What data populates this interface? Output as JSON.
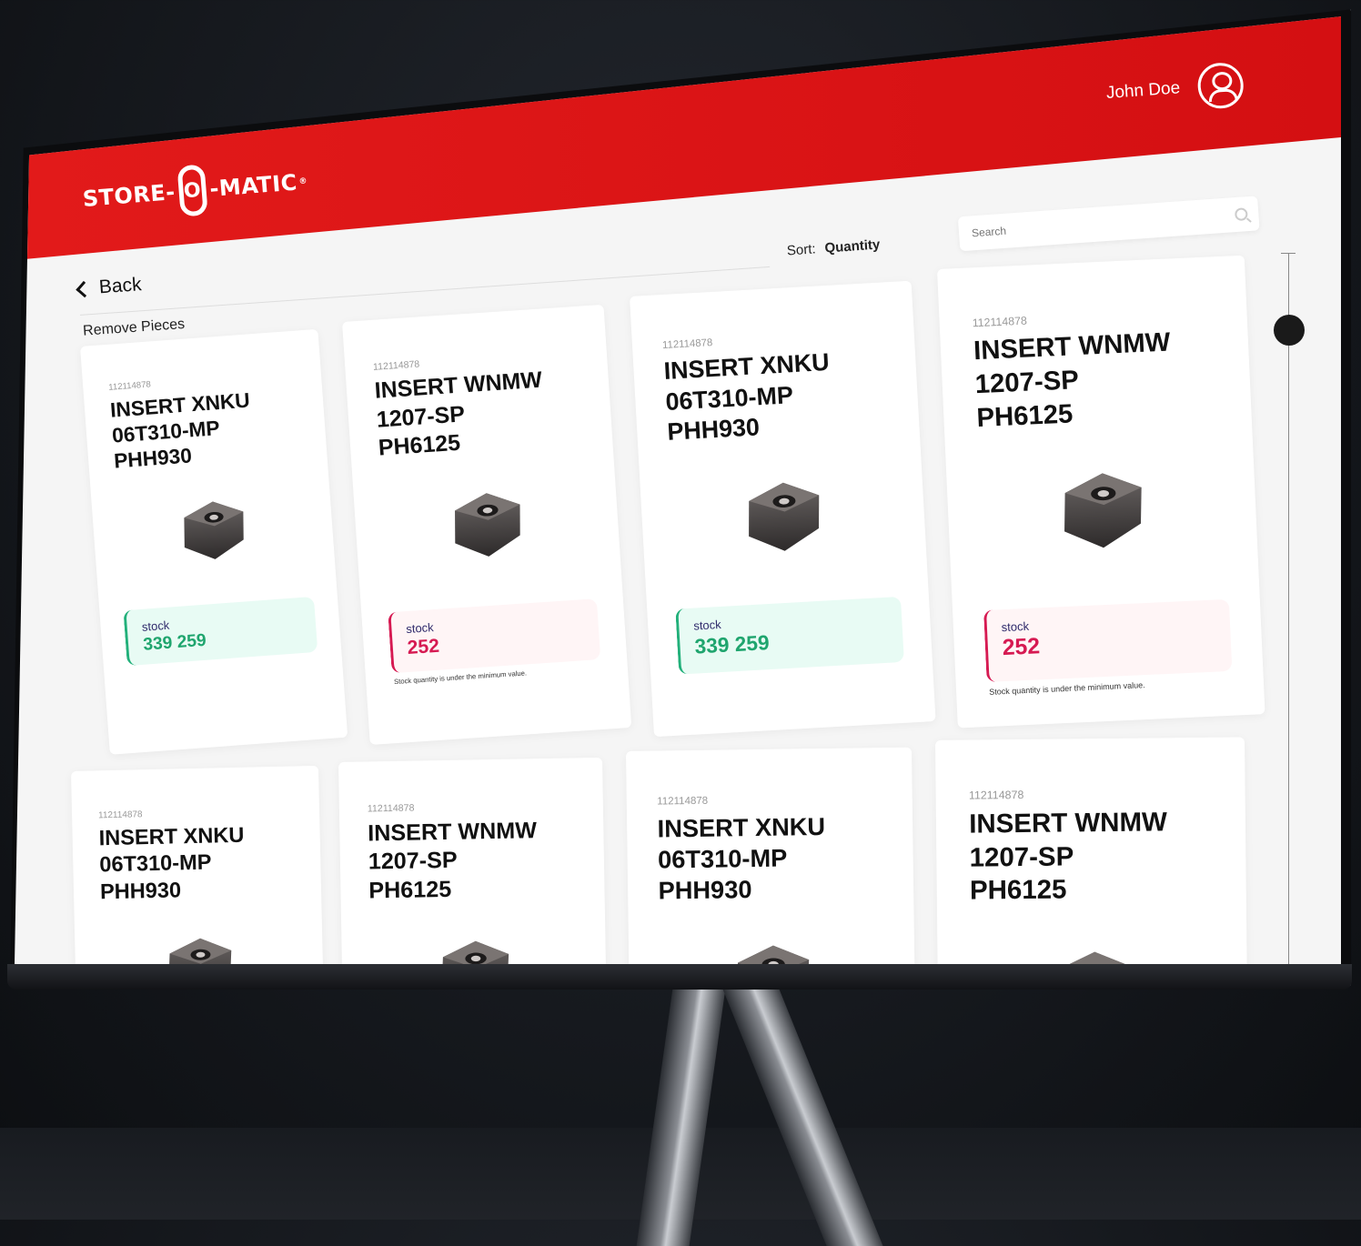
{
  "header": {
    "logo": {
      "left": "STORE-",
      "mark": "O",
      "right": "-MATIC",
      "reg": "®"
    },
    "user_name": "John Doe"
  },
  "toolbar": {
    "back_label": "Back",
    "section_title": "Remove Pieces",
    "sort_label": "Sort:",
    "sort_value": "Quantity",
    "search_placeholder": "Search"
  },
  "cards": [
    {
      "sku": "112114878",
      "name": "INSERT XNKU\n06T310-MP\nPHH930",
      "stock_label": "stock",
      "stock_value": "339 259",
      "status": "ok",
      "note": ""
    },
    {
      "sku": "112114878",
      "name": "INSERT WNMW\n1207-SP\nPH6125",
      "stock_label": "stock",
      "stock_value": "252",
      "status": "low",
      "note": "Stock quantity is under the minimum value."
    },
    {
      "sku": "112114878",
      "name": "INSERT XNKU\n06T310-MP\nPHH930",
      "stock_label": "stock",
      "stock_value": "339 259",
      "status": "ok",
      "note": ""
    },
    {
      "sku": "112114878",
      "name": "INSERT WNMW\n1207-SP\nPH6125",
      "stock_label": "stock",
      "stock_value": "252",
      "status": "low",
      "note": "Stock quantity is under the minimum value."
    },
    {
      "sku": "112114878",
      "name": "INSERT XNKU\n06T310-MP\nPHH930"
    },
    {
      "sku": "112114878",
      "name": "INSERT WNMW\n1207-SP\nPH6125"
    },
    {
      "sku": "112114878",
      "name": "INSERT XNKU\n06T310-MP\nPHH930"
    },
    {
      "sku": "112114878",
      "name": "INSERT WNMW\n1207-SP\nPH6125"
    }
  ],
  "colors": {
    "brand_red": "#e21a1a",
    "stock_ok": "#1fa56e",
    "stock_low": "#d61a52"
  },
  "icons": [
    "user-avatar-icon",
    "chevron-left-icon",
    "search-icon"
  ]
}
